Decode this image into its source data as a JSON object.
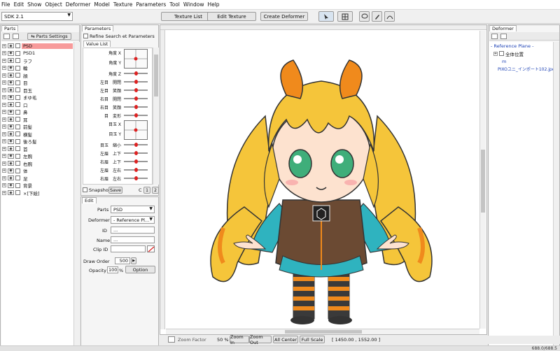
{
  "menu": [
    "File",
    "Edit",
    "Show",
    "Object",
    "Deformer",
    "Model",
    "Texture",
    "Parameters",
    "Tool",
    "Window",
    "Help"
  ],
  "toolbar": {
    "sdk": "SDK 2.1",
    "texture_list": "Texture List",
    "edit_texture": "Edit Texture",
    "create_deformer": "Create Deformer"
  },
  "parts_panel": {
    "title": "Parts",
    "settings": "Parts Settings",
    "items": [
      "PSD",
      "PSD1",
      "ラフ",
      "輪",
      "顔",
      "目",
      "目玉",
      "まゆ毛",
      "口",
      "鼻",
      "耳",
      "前髪",
      "横髪",
      "後ろ髪",
      "首",
      "左腕",
      "右腕",
      "体",
      "足",
      "背景",
      "×[下絵]"
    ]
  },
  "params_panel": {
    "title": "Parameters",
    "refine": "Refine Search et Parameters",
    "value_list": "Value List",
    "rows": [
      "角度 X",
      "角度 Y",
      "角度 Z",
      "左目　開閉",
      "左目　笑顔",
      "右目　開閉",
      "右目　笑顔",
      "目　変形",
      "目玉 X",
      "目玉 Y",
      "目玉　縮小",
      "左眉　上下",
      "右眉　上下",
      "左眉　左右",
      "右眉　左右"
    ],
    "snapshot": "Snapshot",
    "save": "Save",
    "c": "C",
    "p1": "1",
    "p2": "2"
  },
  "edit_panel": {
    "title": "Edit",
    "parts_label": "Parts",
    "parts_value": "PSD",
    "deformer_label": "Deformer",
    "deformer_value": "- Reference Pl...",
    "id_label": "ID",
    "id_value": "...",
    "name_label": "Name",
    "name_value": "...",
    "clip_label": "Clip ID",
    "draw_order_label": "Draw Order",
    "draw_order_value": "500",
    "opacity_label": "Opacity",
    "opacity_value": "100",
    "percent": "%",
    "option": "Option"
  },
  "deformer_panel": {
    "title": "Deformer",
    "root": "- Reference Plane -",
    "item1": "全体位置",
    "item2": "m",
    "item3": "PIXOユニ_インポート102.jpe"
  },
  "statusbar": {
    "zoom_factor": "Zoom Factor",
    "zoom_value": "50 %",
    "zoom_in": "Zoom In",
    "zoom_out": "Zoom Out",
    "all_center": "All Center",
    "full_scale": "Full Scale",
    "coords": "[ 1450.00 , 1552.00 ]",
    "right_coords": "688.0/688.5"
  },
  "colors": {
    "selected_part": "#f79a9a",
    "hair": "#f5c53a",
    "ribbon": "#f08a1c",
    "link": "#1a3fb4"
  }
}
